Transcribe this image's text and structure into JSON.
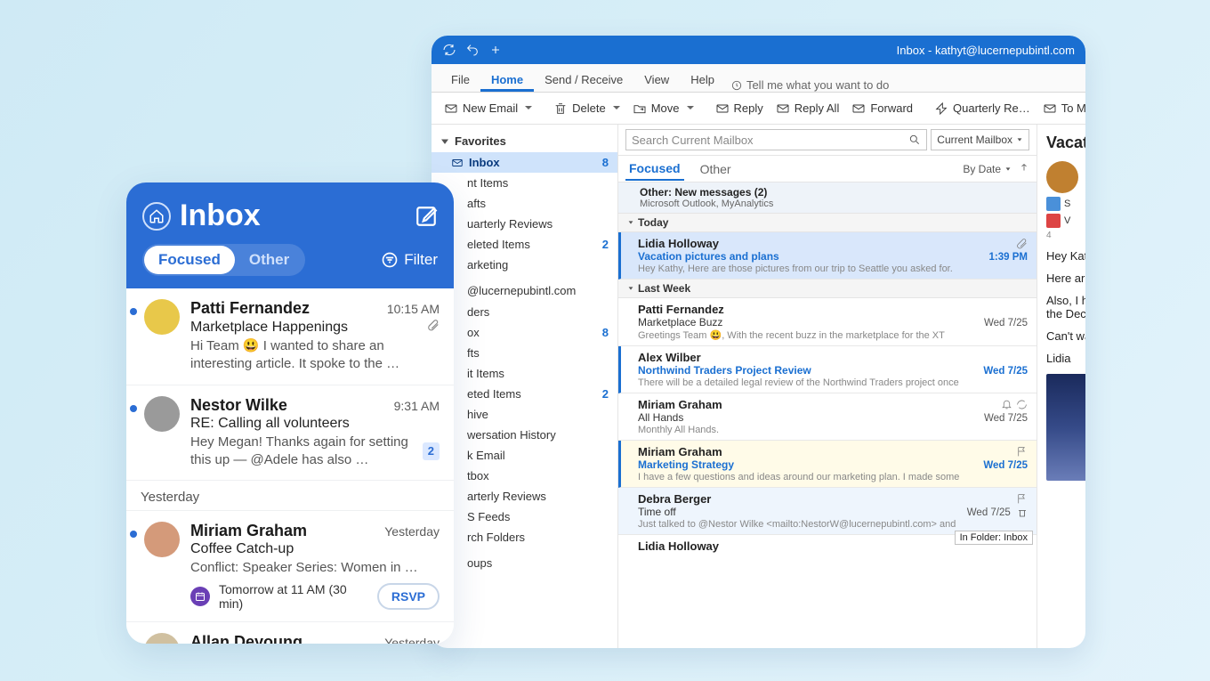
{
  "mobile": {
    "title": "Inbox",
    "pills": {
      "focused": "Focused",
      "other": "Other"
    },
    "filter": "Filter",
    "yesterday": "Yesterday",
    "items": [
      {
        "sender": "Patti Fernandez",
        "time": "10:15 AM",
        "subject": "Marketplace Happenings",
        "preview": "Hi Team 😃 I wanted to share an interesting article. It spoke to the …",
        "unread": true,
        "avatar_bg": "#e8c84a",
        "attach": true,
        "badge": ""
      },
      {
        "sender": "Nestor Wilke",
        "time": "9:31 AM",
        "subject": "RE: Calling all volunteers",
        "preview": "Hey Megan! Thanks again for setting this up — @Adele has also …",
        "unread": true,
        "avatar_bg": "#9a9a9a",
        "attach": false,
        "badge": "2"
      },
      {
        "sender": "Miriam Graham",
        "time": "Yesterday",
        "subject": "Coffee Catch-up",
        "preview": "Conflict: Speaker Series: Women in …",
        "unread": true,
        "avatar_bg": "#d49a7a",
        "attach": false,
        "badge": "",
        "rsvp_text": "Tomorrow at 11 AM (30 min)",
        "rsvp_btn": "RSVP"
      },
      {
        "sender": "Allan Deyoung",
        "time": "Yesterday",
        "subject": "",
        "preview": "",
        "unread": false,
        "avatar_bg": "#d0c0a0",
        "attach": false,
        "badge": ""
      }
    ]
  },
  "desk": {
    "title": "Inbox - kathyt@lucernepubintl.com",
    "tabs": {
      "file": "File",
      "home": "Home",
      "sendrecv": "Send / Receive",
      "view": "View",
      "help": "Help",
      "tellme": "Tell me what you want to do"
    },
    "ribbon": {
      "newemail": "New Email",
      "delete": "Delete",
      "move": "Move",
      "reply": "Reply",
      "replyall": "Reply All",
      "forward": "Forward",
      "quarterly": "Quarterly Re…",
      "tomanager": "To Manager"
    },
    "fav_header": "Favorites",
    "folders1": [
      {
        "label": "Inbox",
        "count": "8",
        "sel": true,
        "icon": true
      },
      {
        "label": "nt Items",
        "count": ""
      },
      {
        "label": "afts",
        "count": ""
      },
      {
        "label": "uarterly Reviews",
        "count": ""
      },
      {
        "label": "eleted Items",
        "count": "2"
      },
      {
        "label": "arketing",
        "count": ""
      }
    ],
    "account": "@lucernepubintl.com",
    "folders2": [
      {
        "label": "ders",
        "count": ""
      },
      {
        "label": "ox",
        "count": "8"
      },
      {
        "label": "fts",
        "count": ""
      },
      {
        "label": "it Items",
        "count": ""
      },
      {
        "label": "eted Items",
        "count": "2"
      },
      {
        "label": "hive",
        "count": ""
      },
      {
        "label": "wersation History",
        "count": ""
      },
      {
        "label": "k Email",
        "count": ""
      },
      {
        "label": "tbox",
        "count": ""
      },
      {
        "label": "arterly Reviews",
        "count": ""
      },
      {
        "label": "S Feeds",
        "count": ""
      },
      {
        "label": "rch Folders",
        "count": ""
      }
    ],
    "groups": "oups",
    "search_placeholder": "Search Current Mailbox",
    "search_scope": "Current Mailbox",
    "focus_tabs": {
      "focused": "Focused",
      "other": "Other",
      "sort": "By Date"
    },
    "other_banner": {
      "title": "Other: New messages (2)",
      "sub": "Microsoft Outlook, MyAnalytics"
    },
    "group_today": "Today",
    "group_lastweek": "Last Week",
    "mails": [
      {
        "sender": "Lidia Holloway",
        "subject": "Vacation pictures and plans",
        "date": "1:39 PM",
        "preview": "Hey Kathy,  Here are those pictures from our trip to Seattle you asked for.",
        "unread": true,
        "sel": true,
        "attach": true
      },
      {
        "sender": "Patti Fernandez",
        "subject": "Marketplace Buzz",
        "date": "Wed 7/25",
        "preview": "Greetings Team 😃,  With the recent buzz in the marketplace for the XT",
        "unread": false,
        "sel": false
      },
      {
        "sender": "Alex Wilber",
        "subject": "Northwind Traders Project Review",
        "date": "Wed 7/25",
        "preview": "There will be a detailed legal review of the Northwind Traders project once",
        "unread": true,
        "sel": false
      },
      {
        "sender": "Miriam Graham",
        "subject": "All Hands",
        "date": "Wed 7/25",
        "preview": "Monthly All Hands.",
        "unread": false,
        "sel": false,
        "bell": true
      },
      {
        "sender": "Miriam Graham",
        "subject": "Marketing Strategy",
        "date": "Wed 7/25",
        "preview": "I have a few questions and ideas around our marketing plan.  I made some",
        "unread": true,
        "sel": false,
        "flag": "red"
      },
      {
        "sender": "Debra Berger",
        "subject": "Time off",
        "date": "Wed 7/25",
        "preview": "Just talked to @Nestor Wilke <mailto:NestorW@lucernepubintl.com> and",
        "unread": false,
        "sel": false,
        "flag": "blue",
        "tooltip": "In Folder: Inbox"
      },
      {
        "sender": "Lidia Holloway",
        "subject": "",
        "date": "",
        "preview": "",
        "unread": false,
        "sel": false
      }
    ],
    "reading": {
      "title": "Vacat",
      "att1": "S",
      "att2": "V",
      "att2b": "4",
      "p1": "Hey Katl",
      "p2": "Here are",
      "p3": "Also, I h",
      "p3b": "the Dece",
      "p4": "Can't wa",
      "p5": "Lidia"
    }
  }
}
